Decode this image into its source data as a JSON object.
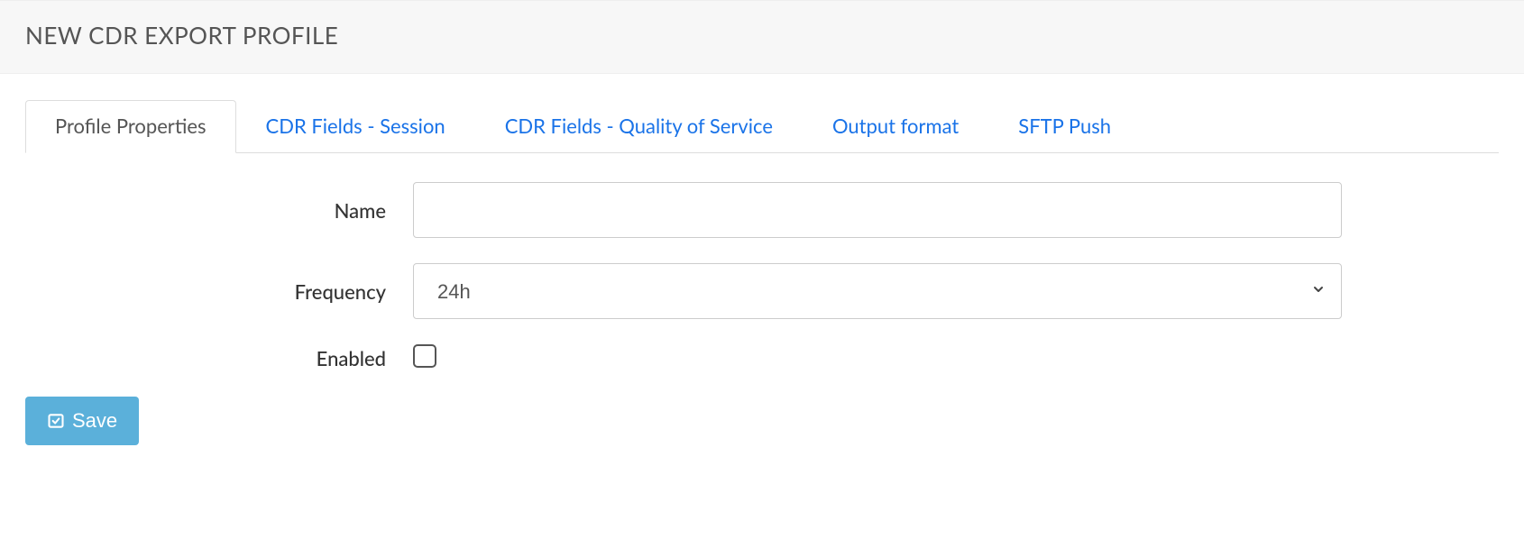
{
  "header": {
    "title": "NEW CDR EXPORT PROFILE"
  },
  "tabs": [
    {
      "label": "Profile Properties",
      "active": true
    },
    {
      "label": "CDR Fields - Session",
      "active": false
    },
    {
      "label": "CDR Fields - Quality of Service",
      "active": false
    },
    {
      "label": "Output format",
      "active": false
    },
    {
      "label": "SFTP Push",
      "active": false
    }
  ],
  "form": {
    "name": {
      "label": "Name",
      "value": ""
    },
    "frequency": {
      "label": "Frequency",
      "value": "24h"
    },
    "enabled": {
      "label": "Enabled",
      "checked": false
    }
  },
  "actions": {
    "save_label": "Save"
  }
}
